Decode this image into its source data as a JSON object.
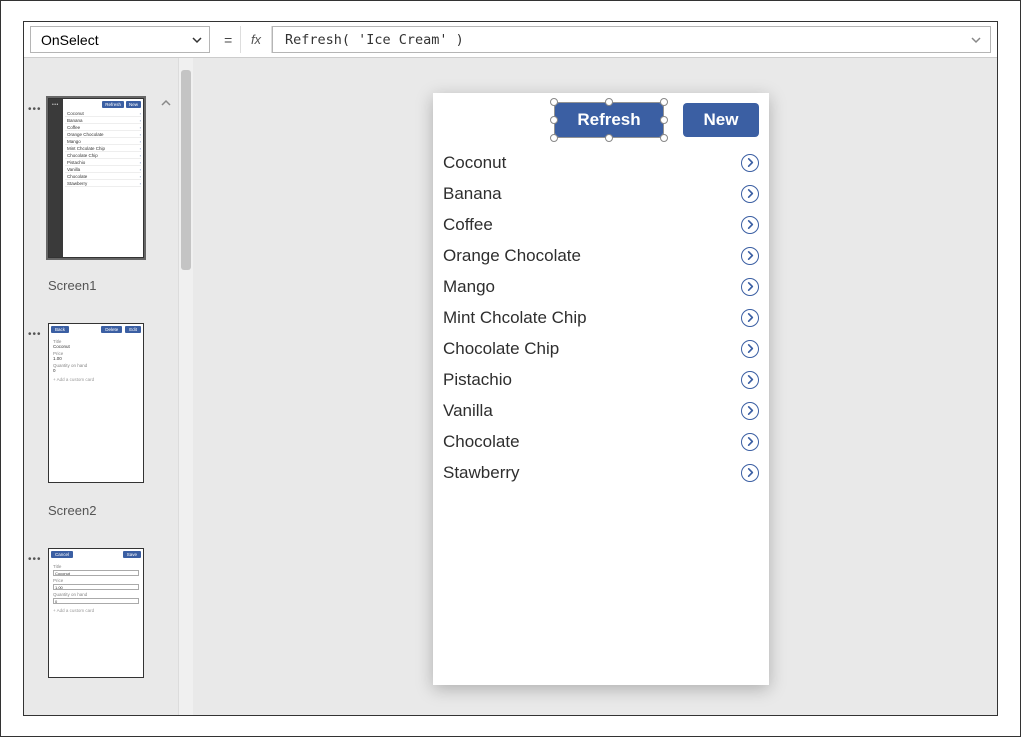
{
  "formula_bar": {
    "property": "OnSelect",
    "eq": "=",
    "fx": "fx",
    "formula": "Refresh( 'Ice Cream' )"
  },
  "tree": {
    "screen1": {
      "label": "Screen1",
      "buttons": {
        "refresh": "Refresh",
        "new": "New"
      },
      "items": [
        "Coconut",
        "Banana",
        "Coffee",
        "Orange Chocolate",
        "Mango",
        "Mint Chcolate Chip",
        "Chocolate Chip",
        "Pistachio",
        "Vanilla",
        "Chocolate",
        "Stawberry"
      ]
    },
    "screen2": {
      "label": "Screen2",
      "buttons": {
        "back": "Back",
        "delete": "Delete",
        "edit": "Edit"
      },
      "fields": {
        "title_label": "Title",
        "title_value": "Coconut",
        "price_label": "Price",
        "price_value": "1.00",
        "qty_label": "Quantity on hand",
        "qty_value": "0",
        "add": "+  Add a custom card"
      }
    },
    "screen3": {
      "buttons": {
        "cancel": "Cancel",
        "save": "Save"
      },
      "fields": {
        "title_label": "Title",
        "title_value": "Coconut",
        "price_label": "Price",
        "price_value": "1.00",
        "qty_label": "Quantity on hand",
        "qty_value": "0",
        "add": "+  Add a custom card"
      }
    }
  },
  "canvas": {
    "buttons": {
      "refresh": "Refresh",
      "new": "New"
    },
    "gallery": [
      "Coconut",
      "Banana",
      "Coffee",
      "Orange Chocolate",
      "Mango",
      "Mint Chcolate Chip",
      "Chocolate Chip",
      "Pistachio",
      "Vanilla",
      "Chocolate",
      "Stawberry"
    ]
  },
  "colors": {
    "primary": "#3b5fa3"
  }
}
